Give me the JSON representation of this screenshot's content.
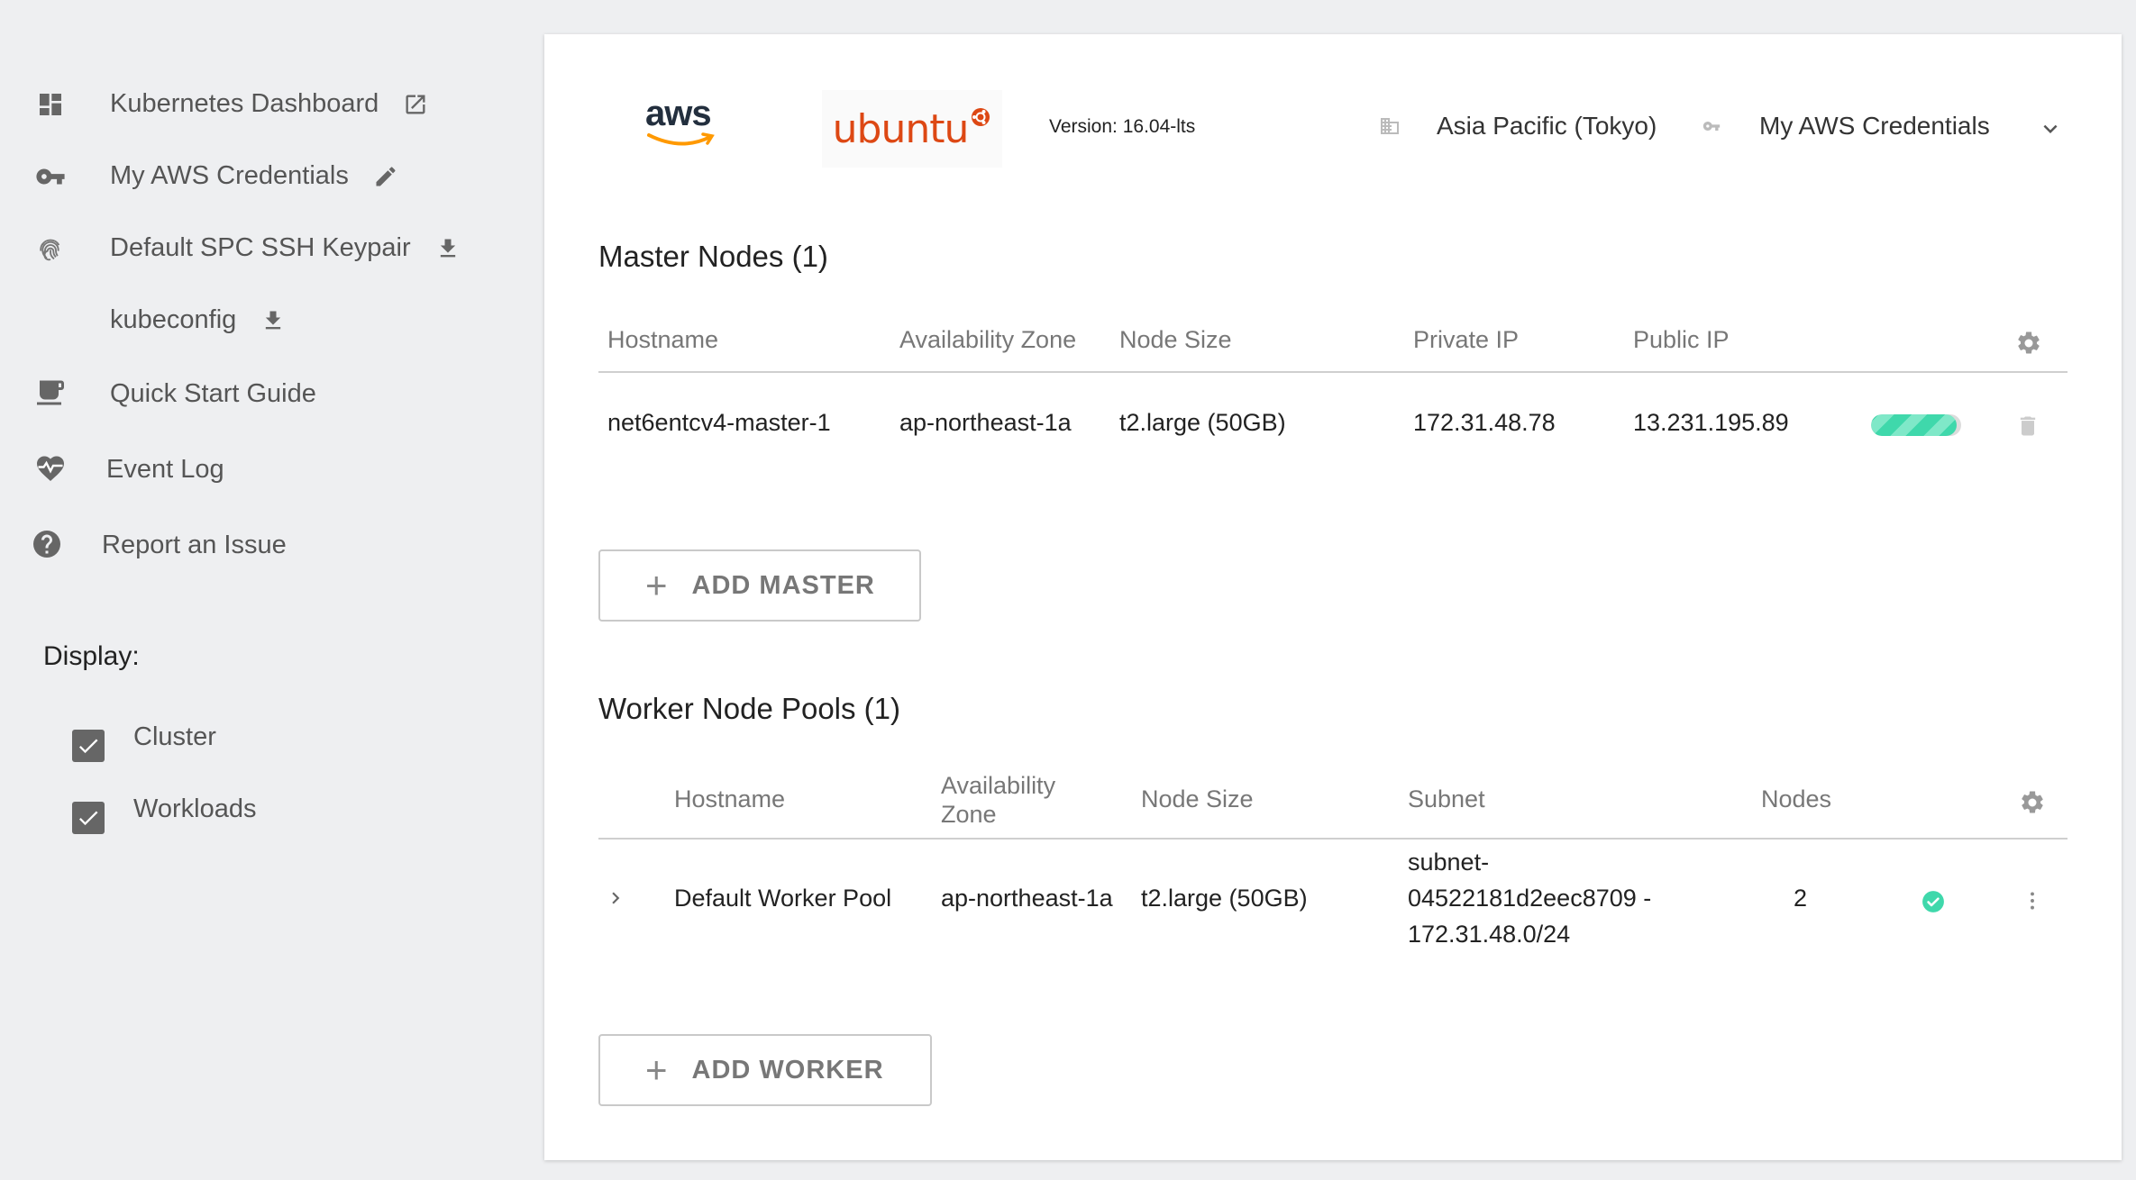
{
  "sidebar": {
    "items": [
      {
        "label": "Kubernetes Dashboard",
        "icon": "dashboard-icon",
        "trail_icon": "external-link-icon"
      },
      {
        "label": "My AWS Credentials",
        "icon": "key-icon",
        "trail_icon": "pencil-icon"
      },
      {
        "label": "Default SPC SSH Keypair",
        "icon": "fingerprint-icon",
        "trail_icon": "download-icon"
      },
      {
        "label": "kubeconfig",
        "icon": "",
        "trail_icon": "download-icon"
      },
      {
        "label": "Quick Start Guide",
        "icon": "coffee-icon"
      },
      {
        "label": "Event Log",
        "icon": "heartbeat-icon"
      },
      {
        "label": "Report an Issue",
        "icon": "help-icon"
      }
    ],
    "display": {
      "title": "Display:",
      "options": [
        {
          "label": "Cluster",
          "checked": true
        },
        {
          "label": "Workloads",
          "checked": true
        }
      ]
    }
  },
  "header": {
    "provider_logo": "aws",
    "os_logo": "ubuntu",
    "version": "Version: 16.04-lts",
    "region": "Asia Pacific (Tokyo)",
    "credentials": "My AWS Credentials"
  },
  "master": {
    "title": "Master Nodes (1)",
    "columns": [
      "Hostname",
      "Availability Zone",
      "Node Size",
      "Private IP",
      "Public IP"
    ],
    "rows": [
      {
        "hostname": "net6entcv4-master-1",
        "zone": "ap-northeast-1a",
        "size": "t2.large (50GB)",
        "private_ip": "172.31.48.78",
        "public_ip": "13.231.195.89",
        "progress": 0.95
      }
    ],
    "add_label": "ADD MASTER"
  },
  "workers": {
    "title": "Worker Node Pools (1)",
    "columns": [
      "Hostname",
      "Availability Zone",
      "Node Size",
      "Subnet",
      "Nodes"
    ],
    "rows": [
      {
        "hostname": "Default Worker Pool",
        "zone": "ap-northeast-1a",
        "size": "t2.large (50GB)",
        "subnet_line1": "subnet-",
        "subnet_line2": "04522181d2eec8709 -",
        "subnet_line3": "172.31.48.0/24",
        "nodes": "2",
        "status": "ok"
      }
    ],
    "add_label": "ADD WORKER"
  },
  "colors": {
    "accent": "#3fd8ab",
    "ubuntu": "#dd4814",
    "aws_smile": "#ff9900"
  }
}
